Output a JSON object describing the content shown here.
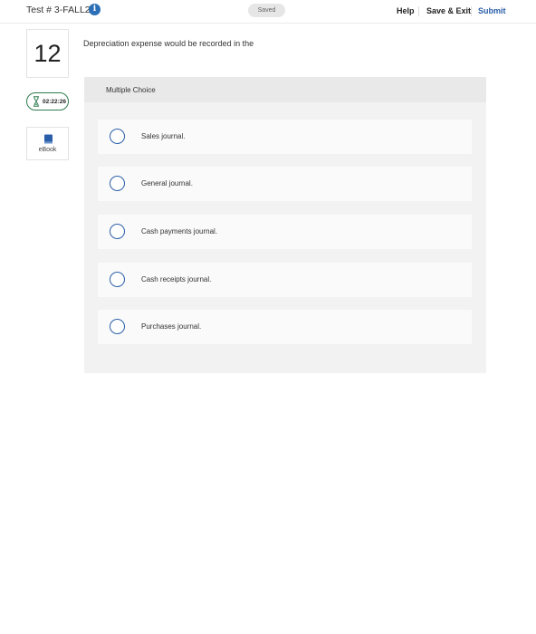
{
  "header": {
    "test_title": "Test # 3-FALL22",
    "info_glyph": "i",
    "saved_status": "Saved",
    "help_label": "Help",
    "save_exit_label": "Save & Exit",
    "submit_label": "Submit"
  },
  "sidebar": {
    "question_number": "12",
    "timer": "02:22:26",
    "ebook_label": "eBook"
  },
  "question": {
    "text": "Depreciation expense would be recorded in the",
    "type_label": "Multiple Choice",
    "options": [
      "Sales journal.",
      "General journal.",
      "Cash payments journal.",
      "Cash receipts journal.",
      "Purchases journal."
    ]
  },
  "colors": {
    "accent": "#2a5ea8",
    "timer_border": "#2e7d4f",
    "info_icon": "#2a6fb7"
  },
  "icons": [
    "info-icon",
    "hourglass-icon",
    "book-icon",
    "radio-button"
  ]
}
